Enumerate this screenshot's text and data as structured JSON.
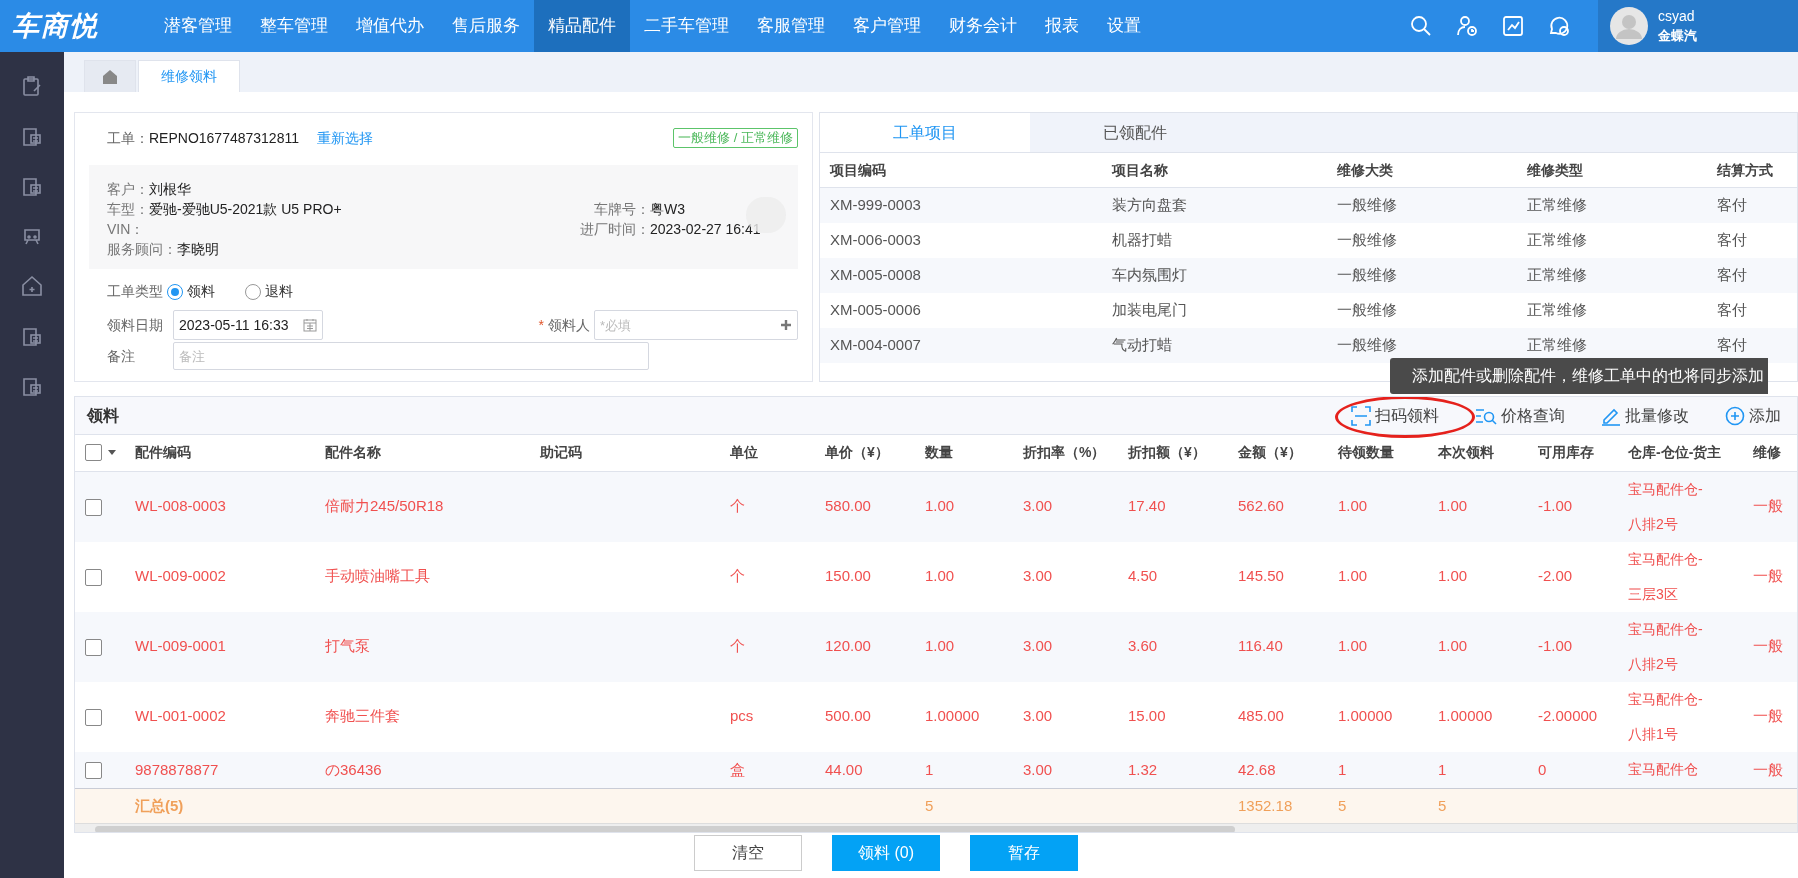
{
  "nav": {
    "logo": "车商悦",
    "items": [
      {
        "label": "潜客管理",
        "selected": false
      },
      {
        "label": "整车管理",
        "selected": false
      },
      {
        "label": "增值代办",
        "selected": false
      },
      {
        "label": "售后服务",
        "selected": false
      },
      {
        "label": "精品配件",
        "selected": true
      },
      {
        "label": "二手车管理",
        "selected": false
      },
      {
        "label": "客服管理",
        "selected": false
      },
      {
        "label": "客户管理",
        "selected": false
      },
      {
        "label": "财务会计",
        "selected": false
      },
      {
        "label": "报表",
        "selected": false
      },
      {
        "label": "设置",
        "selected": false
      }
    ],
    "user": {
      "name": "csyad",
      "company": "金蝶汽"
    }
  },
  "page_tabs": [
    {
      "kind": "home",
      "selected": false
    },
    {
      "kind": "text",
      "label": "维修领料",
      "selected": true
    }
  ],
  "work_order": {
    "label": "工单：",
    "number": "REPNO1677487312811",
    "reselect": "重新选择",
    "tag": "一般维修 / 正常维修"
  },
  "info_left": [
    {
      "label": "客户：",
      "value": "刘根华"
    },
    {
      "label": "车型：",
      "value": "爱驰-爱驰U5-2021款 U5 PRO+"
    },
    {
      "label": "VIN："
    },
    {
      "label": "服务顾问：",
      "value": "李晓明"
    }
  ],
  "info_right": [
    {
      "label": "车牌号：",
      "value": "粤W3"
    },
    {
      "label": "进厂时间：",
      "value": "2023-02-27 16:41"
    }
  ],
  "order_type": {
    "label": "工单类型",
    "options": [
      {
        "label": "领料",
        "selected": true
      },
      {
        "label": "退料",
        "selected": false
      }
    ]
  },
  "date_field": {
    "label": "领料日期",
    "value": "2023-05-11 16:33"
  },
  "receiver_field": {
    "label": "领料人",
    "required_mark": "*",
    "placeholder": "*必填"
  },
  "note_field": {
    "label": "备注",
    "placeholder": "备注"
  },
  "project_panel": {
    "tabs": [
      {
        "label": "工单项目",
        "selected": true
      },
      {
        "label": "已领配件",
        "selected": false
      }
    ],
    "columns": [
      "项目编码",
      "项目名称",
      "维修大类",
      "维修类型",
      "结算方式"
    ],
    "rows": [
      [
        "XM-999-0003",
        "装方向盘套",
        "一般维修",
        "正常维修",
        "客付"
      ],
      [
        "XM-006-0003",
        "机器打蜡",
        "一般维修",
        "正常维修",
        "客付"
      ],
      [
        "XM-005-0008",
        "车内氛围灯",
        "一般维修",
        "正常维修",
        "客付"
      ],
      [
        "XM-005-0006",
        "加装电尾门",
        "一般维修",
        "正常维修",
        "客付"
      ],
      [
        "XM-004-0007",
        "气动打蜡",
        "一般维修",
        "正常维修",
        "客付"
      ]
    ]
  },
  "tooltip": "添加配件或删除配件，维修工单中的也将同步添加",
  "parts": {
    "title": "领料",
    "toolbar": [
      {
        "kind": "scan",
        "label": "扫码领料",
        "highlighted": true
      },
      {
        "kind": "price",
        "label": "价格查询",
        "highlighted": false
      },
      {
        "kind": "edit",
        "label": "批量修改",
        "highlighted": false
      },
      {
        "kind": "add",
        "label": "添加",
        "highlighted": false
      }
    ],
    "select_all": {
      "checked": false
    },
    "columns": [
      "配件编码",
      "配件名称",
      "助记码",
      "单位",
      "单价（¥）",
      "数量",
      "折扣率（%）",
      "折扣额（¥）",
      "金额（¥）",
      "待领数量",
      "本次领料",
      "可用库存",
      "仓库-仓位-货主",
      "维修"
    ],
    "rows": [
      {
        "checked": false,
        "cells": [
          "WL-008-0003",
          "倍耐力245/50R18",
          "",
          "个",
          "580.00",
          "1.00",
          "3.00",
          "17.40",
          "562.60",
          "1.00",
          "1.00",
          "-1.00",
          "宝马配件仓-八排2号",
          "一般"
        ]
      },
      {
        "checked": false,
        "cells": [
          "WL-009-0002",
          "手动喷油嘴工具",
          "",
          "个",
          "150.00",
          "1.00",
          "3.00",
          "4.50",
          "145.50",
          "1.00",
          "1.00",
          "-2.00",
          "宝马配件仓-三层3区",
          "一般"
        ]
      },
      {
        "checked": false,
        "cells": [
          "WL-009-0001",
          "打气泵",
          "",
          "个",
          "120.00",
          "1.00",
          "3.00",
          "3.60",
          "116.40",
          "1.00",
          "1.00",
          "-1.00",
          "宝马配件仓-八排2号",
          "一般"
        ]
      },
      {
        "checked": false,
        "cells": [
          "WL-001-0002",
          "奔驰三件套",
          "",
          "pcs",
          "500.00",
          "1.00000",
          "3.00",
          "15.00",
          "485.00",
          "1.00000",
          "1.00000",
          "-2.00000",
          "宝马配件仓-八排1号",
          "一般"
        ]
      },
      {
        "checked": false,
        "cells": [
          "9878878877",
          "の36436",
          "",
          "盒",
          "44.00",
          "1",
          "3.00",
          "1.32",
          "42.68",
          "1",
          "1",
          "0",
          "宝马配件仓",
          "一般"
        ]
      }
    ],
    "summary": {
      "label": "汇总(5)",
      "quantity": "5",
      "amount": "1352.18",
      "pending": "5",
      "issued": "5"
    }
  },
  "buttons": [
    {
      "kind": "plain",
      "label": "清空"
    },
    {
      "kind": "primary",
      "label": "领料 (0)"
    },
    {
      "kind": "primary",
      "label": "暂存"
    }
  ]
}
